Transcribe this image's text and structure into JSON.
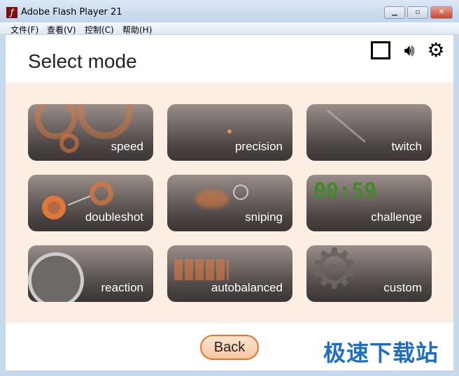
{
  "window": {
    "title": "Adobe Flash Player 21",
    "controls": [
      "minimize",
      "maximize",
      "close"
    ]
  },
  "menu": [
    "文件(F)",
    "查看(V)",
    "控制(C)",
    "帮助(H)"
  ],
  "header": {
    "title": "Select mode",
    "icons": [
      "fullscreen-icon",
      "speaker-icon",
      "gear-icon"
    ]
  },
  "modes": [
    {
      "label": "speed"
    },
    {
      "label": "precision"
    },
    {
      "label": "twitch"
    },
    {
      "label": "doubleshot"
    },
    {
      "label": "sniping"
    },
    {
      "label": "challenge",
      "timer": "00:59"
    },
    {
      "label": "reaction"
    },
    {
      "label": "autobalanced"
    },
    {
      "label": "custom"
    }
  ],
  "footer": {
    "back_label": "Back",
    "watermark": "极速下载站"
  },
  "colors": {
    "accent": "#e8722a",
    "panel": "#fdeee4",
    "timer": "#3f8a2a"
  }
}
